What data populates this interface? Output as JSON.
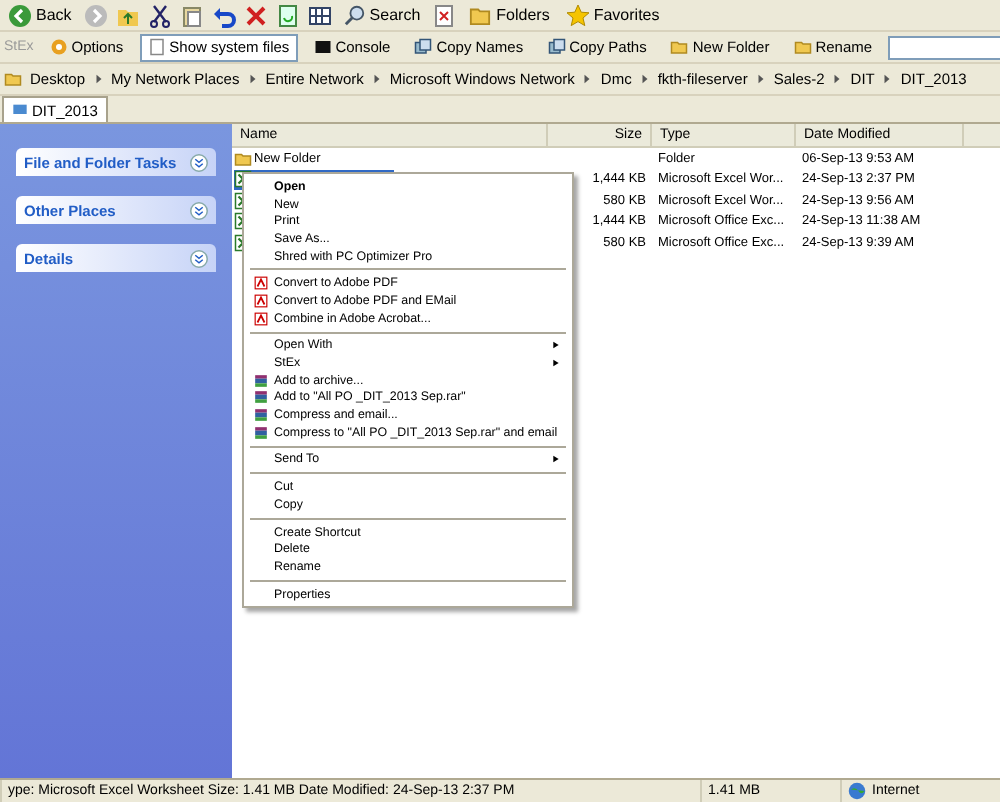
{
  "toolbar": {
    "back": "Back",
    "search": "Search",
    "folders": "Folders",
    "favorites": "Favorites"
  },
  "stex_bar": {
    "label": "StEx",
    "buttons": [
      {
        "label": "Options",
        "pressed": false
      },
      {
        "label": "Show system files",
        "pressed": true
      },
      {
        "label": "Console",
        "pressed": false
      },
      {
        "label": "Copy Names",
        "pressed": false
      },
      {
        "label": "Copy Paths",
        "pressed": false
      },
      {
        "label": "New Folder",
        "pressed": false
      },
      {
        "label": "Rename",
        "pressed": false
      }
    ]
  },
  "breadcrumbs": [
    "Desktop",
    "My Network Places",
    "Entire Network",
    "Microsoft Windows Network",
    "Dmc",
    "fkth-fileserver",
    "Sales-2",
    "DIT",
    "DIT_2013"
  ],
  "tabs": [
    {
      "label": "DIT_2013",
      "selected": true
    }
  ],
  "task_panes": [
    "File and Folder Tasks",
    "Other Places",
    "Details"
  ],
  "columns": {
    "name": "Name",
    "size": "Size",
    "type": "Type",
    "date": "Date Modified"
  },
  "files": [
    {
      "name": "New Folder",
      "kind": "folder",
      "type": "Folder",
      "date": "06-Sep-13 9:53 AM",
      "selected": false
    },
    {
      "kind": "excel",
      "size": "1,444 KB",
      "type": "Microsoft Excel Wor...",
      "date": "24-Sep-13 2:37 PM",
      "selected": true
    },
    {
      "kind": "excel",
      "size": "580 KB",
      "type": "Microsoft Excel Wor...",
      "date": "24-Sep-13 9:56 AM",
      "selected": false
    },
    {
      "kind": "excel",
      "size": "1,444 KB",
      "type": "Microsoft Office Exc...",
      "date": "24-Sep-13 11:38 AM",
      "selected": false
    },
    {
      "kind": "excel",
      "size": "580 KB",
      "type": "Microsoft Office Exc...",
      "date": "24-Sep-13 9:39 AM",
      "selected": false
    }
  ],
  "context_menu": [
    {
      "kind": "item",
      "label": "Open",
      "bold": true,
      "submenu": false
    },
    {
      "kind": "item",
      "label": "New",
      "bold": false,
      "submenu": false
    },
    {
      "kind": "item",
      "label": "Print",
      "bold": false,
      "submenu": false
    },
    {
      "kind": "item",
      "label": "Save As...",
      "bold": false,
      "submenu": false
    },
    {
      "kind": "item",
      "label": "Shred with PC Optimizer Pro",
      "bold": false,
      "submenu": false
    },
    {
      "kind": "separator"
    },
    {
      "kind": "pdf",
      "label": "Convert to Adobe PDF",
      "bold": false,
      "submenu": false
    },
    {
      "kind": "pdf",
      "label": "Convert to Adobe PDF and EMail",
      "bold": false,
      "submenu": false
    },
    {
      "kind": "pdf",
      "label": "Combine in Adobe Acrobat...",
      "bold": false,
      "submenu": false
    },
    {
      "kind": "separator"
    },
    {
      "kind": "item",
      "label": "Open With",
      "bold": false,
      "submenu": true
    },
    {
      "kind": "item",
      "label": "StEx",
      "bold": false,
      "submenu": true
    },
    {
      "kind": "archive",
      "label": "Add to archive...",
      "bold": false,
      "submenu": false
    },
    {
      "kind": "archive",
      "label": "Add to \"All PO _DIT_2013 Sep.rar\"",
      "bold": false,
      "submenu": false
    },
    {
      "kind": "archive",
      "label": "Compress and email...",
      "bold": false,
      "submenu": false
    },
    {
      "kind": "archive",
      "label": "Compress to \"All PO _DIT_2013 Sep.rar\" and email",
      "bold": false,
      "submenu": false
    },
    {
      "kind": "separator"
    },
    {
      "kind": "item",
      "label": "Send To",
      "bold": false,
      "submenu": true
    },
    {
      "kind": "separator"
    },
    {
      "kind": "item",
      "label": "Cut",
      "bold": false,
      "submenu": false
    },
    {
      "kind": "item",
      "label": "Copy",
      "bold": false,
      "submenu": false
    },
    {
      "kind": "separator"
    },
    {
      "kind": "item",
      "label": "Create Shortcut",
      "bold": false,
      "submenu": false
    },
    {
      "kind": "item",
      "label": "Delete",
      "bold": false,
      "submenu": false
    },
    {
      "kind": "item",
      "label": "Rename",
      "bold": false,
      "submenu": false
    },
    {
      "kind": "separator"
    },
    {
      "kind": "item",
      "label": "Properties",
      "bold": false,
      "submenu": false
    }
  ],
  "status_bar": {
    "text": "ype: Microsoft Excel Worksheet Size: 1.41 MB Date Modified: 24-Sep-13 2:37 PM",
    "size": "1.41 MB",
    "zone": "Internet"
  }
}
